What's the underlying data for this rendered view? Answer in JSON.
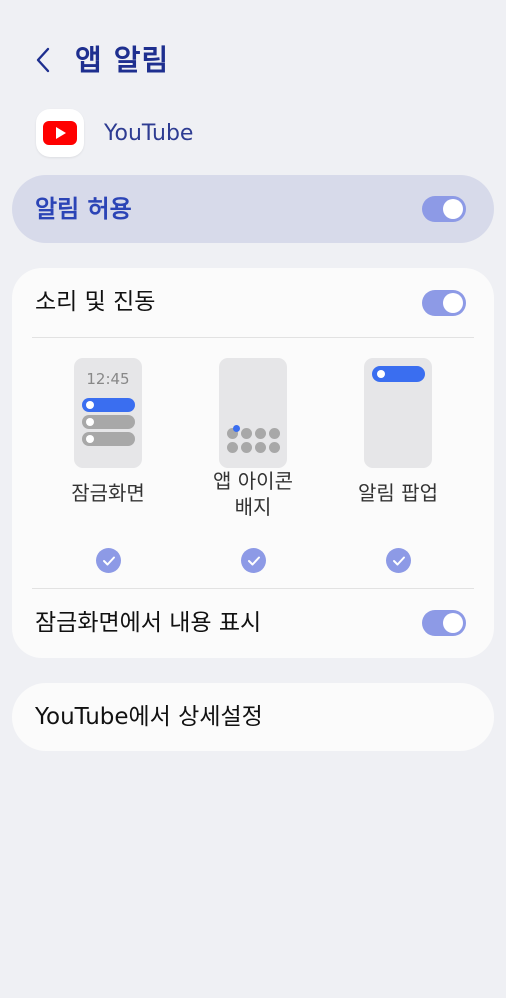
{
  "header": {
    "title": "앱 알림"
  },
  "app": {
    "name": "YouTube"
  },
  "allow": {
    "label": "알림 허용",
    "enabled": true
  },
  "sound": {
    "label": "소리 및 진동",
    "enabled": true
  },
  "styles": {
    "lock_screen": {
      "label": "잠금화면",
      "time": "12:45",
      "checked": true
    },
    "badge": {
      "label": "앱 아이콘\n배지",
      "checked": true
    },
    "popup": {
      "label": "알림 팝업",
      "checked": true
    }
  },
  "lockscreen_content": {
    "label": "잠금화면에서 내용 표시",
    "enabled": true
  },
  "advanced": {
    "label": "YouTube에서 상세설정"
  },
  "colors": {
    "accent": "#8d9ae6",
    "title": "#1e2f8f",
    "allow_bg": "#d7daea",
    "youtube_red": "#ff0000"
  }
}
